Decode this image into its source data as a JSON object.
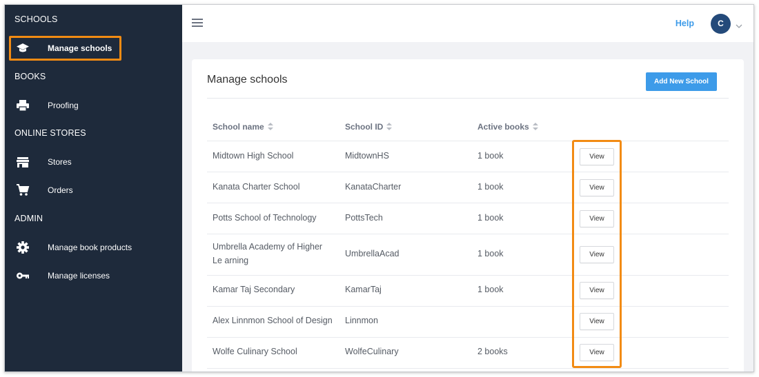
{
  "sidebar": {
    "sections": [
      {
        "title": "SCHOOLS",
        "items": [
          {
            "label": "Manage schools",
            "icon": "graduation-cap-icon"
          }
        ]
      },
      {
        "title": "BOOKS",
        "items": [
          {
            "label": "Proofing",
            "icon": "printer-icon"
          }
        ]
      },
      {
        "title": "ONLINE STORES",
        "items": [
          {
            "label": "Stores",
            "icon": "storefront-icon"
          },
          {
            "label": "Orders",
            "icon": "cart-icon"
          }
        ]
      },
      {
        "title": "ADMIN",
        "items": [
          {
            "label": "Manage book products",
            "icon": "gear-icon"
          },
          {
            "label": "Manage licenses",
            "icon": "key-icon"
          }
        ]
      }
    ]
  },
  "header": {
    "help_label": "Help",
    "avatar_initial": "C"
  },
  "main": {
    "title": "Manage schools",
    "add_button_label": "Add New School",
    "columns": [
      "School name",
      "School ID",
      "Active books"
    ],
    "view_label": "View",
    "rows": [
      {
        "name": "Midtown High School",
        "id": "MidtownHS",
        "books": "1 book"
      },
      {
        "name": "Kanata Charter School",
        "id": "KanataCharter",
        "books": "1 book"
      },
      {
        "name": "Potts School of Technology",
        "id": "PottsTech",
        "books": "1 book"
      },
      {
        "name": "Umbrella Academy of Higher Le arning",
        "id": "UmbrellaAcad",
        "books": "1 book"
      },
      {
        "name": "Kamar Taj Secondary",
        "id": "KamarTaj",
        "books": "1 book"
      },
      {
        "name": "Alex Linnmon School of Design",
        "id": "Linnmon",
        "books": ""
      },
      {
        "name": "Wolfe Culinary School",
        "id": "WolfeCulinary",
        "books": "2 books"
      }
    ]
  },
  "colors": {
    "sidebar_bg": "#1e2a3b",
    "accent": "#3d9be9",
    "highlight": "#f28b13",
    "avatar_bg": "#244a7a"
  }
}
